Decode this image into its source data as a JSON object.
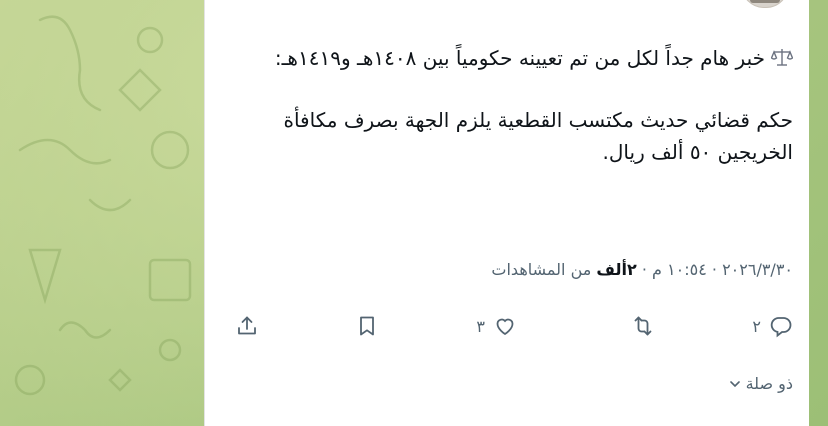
{
  "tweet": {
    "line1": "خبر هام جداً لكل من تم تعيينه حكومياً بين ١٤٠٨هـ و١٤١٩هـ:",
    "line2": "حكم قضائي حديث مكتسب القطعية يلزم الجهة بصرف مكافأة الخريجين ٥٠ ألف ريال.",
    "scale_icon": "balance-scale-icon"
  },
  "meta": {
    "date": "٢٠٢٦/٣/٣٠",
    "time": "١٠:٥٤ م",
    "views_count": "٢ألف",
    "views_label": "من المشاهدات",
    "sep": "·"
  },
  "actions": {
    "reply_count": "٢",
    "retweet_count": "",
    "like_count": "٣",
    "reply_icon": "reply-icon",
    "retweet_icon": "retweet-icon",
    "like_icon": "heart-icon",
    "bookmark_icon": "bookmark-icon",
    "share_icon": "share-icon"
  },
  "thread": {
    "label": "ذو صلة"
  },
  "colors": {
    "text": "#0f1419",
    "muted": "#536471",
    "background": "#ffffff",
    "wallpaper": "#b9d08f"
  }
}
